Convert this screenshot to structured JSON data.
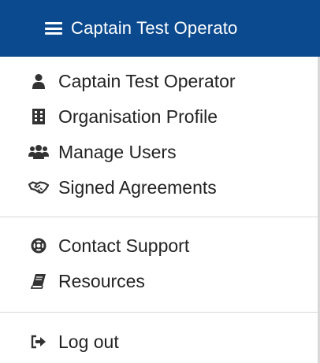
{
  "header": {
    "title": "Captain Test Operato",
    "menu_icon": "hamburger-icon",
    "background": "#0b4a8e"
  },
  "menu": {
    "groups": [
      {
        "items": [
          {
            "label": "Captain Test Operator",
            "icon": "user-icon"
          },
          {
            "label": "Organisation Profile",
            "icon": "building-icon"
          },
          {
            "label": "Manage Users",
            "icon": "users-icon"
          },
          {
            "label": "Signed Agreements",
            "icon": "handshake-icon"
          }
        ]
      },
      {
        "items": [
          {
            "label": "Contact Support",
            "icon": "life-ring-icon"
          },
          {
            "label": "Resources",
            "icon": "book-icon"
          }
        ]
      },
      {
        "items": [
          {
            "label": "Log out",
            "icon": "sign-out-icon"
          }
        ]
      }
    ]
  }
}
